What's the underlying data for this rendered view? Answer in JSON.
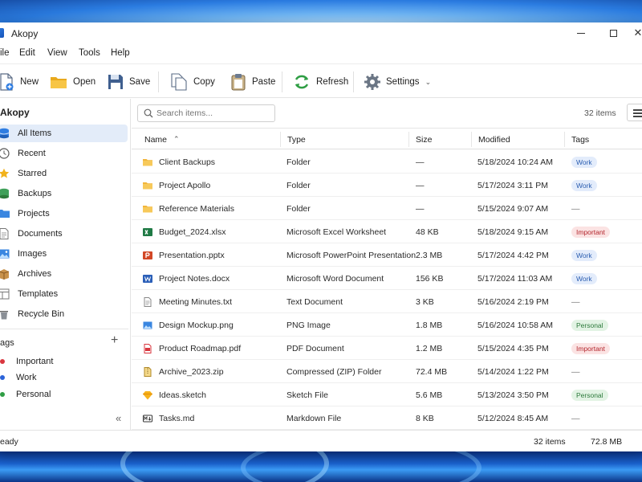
{
  "window": {
    "title": "Akopy"
  },
  "menu": [
    "ile",
    "Edit",
    "View",
    "Tools",
    "Help"
  ],
  "toolbar": {
    "new": "New",
    "open": "Open",
    "save": "Save",
    "copy": "Copy",
    "paste": "Paste",
    "refresh": "Refresh",
    "settings": "Settings"
  },
  "sidebar": {
    "header": "Akopy",
    "items": [
      {
        "label": "All Items",
        "icon": "database-icon",
        "active": true
      },
      {
        "label": "Recent",
        "icon": "clock-icon"
      },
      {
        "label": "Starred",
        "icon": "star-icon"
      },
      {
        "label": "Backups",
        "icon": "backup-icon"
      },
      {
        "label": "Projects",
        "icon": "folder-icon"
      },
      {
        "label": "Documents",
        "icon": "document-icon"
      },
      {
        "label": "Images",
        "icon": "image-icon"
      },
      {
        "label": "Archives",
        "icon": "archive-box-icon"
      },
      {
        "label": "Templates",
        "icon": "template-icon"
      },
      {
        "label": "Recycle Bin",
        "icon": "trash-icon"
      }
    ],
    "tags_header": "ags",
    "add_tag": "+",
    "tags": [
      {
        "label": "Important",
        "color": "#d9363e"
      },
      {
        "label": "Work",
        "color": "#2b63d9"
      },
      {
        "label": "Personal",
        "color": "#2f9e44"
      }
    ],
    "collapse": "«"
  },
  "main": {
    "search_placeholder": "Search items...",
    "item_count": "32 items",
    "columns": {
      "name": "Name",
      "type": "Type",
      "size": "Size",
      "modified": "Modified",
      "tags": "Tags"
    },
    "rows": [
      {
        "name": "Client Backups",
        "icon": "folder-icon",
        "type": "Folder",
        "size": "—",
        "modified": "5/18/2024 10:24 AM",
        "tag": "Work"
      },
      {
        "name": "Project Apollo",
        "icon": "folder-icon",
        "type": "Folder",
        "size": "—",
        "modified": "5/17/2024 3:11 PM",
        "tag": "Work"
      },
      {
        "name": "Reference Materials",
        "icon": "folder-icon",
        "type": "Folder",
        "size": "—",
        "modified": "5/15/2024 9:07 AM",
        "tag": "—"
      },
      {
        "name": "Budget_2024.xlsx",
        "icon": "excel-icon",
        "type": "Microsoft Excel Worksheet",
        "size": "48 KB",
        "modified": "5/18/2024 9:15 AM",
        "tag": "Important"
      },
      {
        "name": "Presentation.pptx",
        "icon": "powerpoint-icon",
        "type": "Microsoft PowerPoint Presentation",
        "size": "2.3 MB",
        "modified": "5/17/2024 4:42 PM",
        "tag": "Work"
      },
      {
        "name": "Project Notes.docx",
        "icon": "word-icon",
        "type": "Microsoft Word Document",
        "size": "156 KB",
        "modified": "5/17/2024 11:03 AM",
        "tag": "Work"
      },
      {
        "name": "Meeting Minutes.txt",
        "icon": "text-file-icon",
        "type": "Text Document",
        "size": "3 KB",
        "modified": "5/16/2024 2:19 PM",
        "tag": "—"
      },
      {
        "name": "Design Mockup.png",
        "icon": "image-file-icon",
        "type": "PNG Image",
        "size": "1.8 MB",
        "modified": "5/16/2024 10:58 AM",
        "tag": "Personal"
      },
      {
        "name": "Product Roadmap.pdf",
        "icon": "pdf-icon",
        "type": "PDF Document",
        "size": "1.2 MB",
        "modified": "5/15/2024 4:35 PM",
        "tag": "Important"
      },
      {
        "name": "Archive_2023.zip",
        "icon": "zip-icon",
        "type": "Compressed (ZIP) Folder",
        "size": "72.4 MB",
        "modified": "5/14/2024 1:22 PM",
        "tag": "—"
      },
      {
        "name": "Ideas.sketch",
        "icon": "sketch-icon",
        "type": "Sketch File",
        "size": "5.6 MB",
        "modified": "5/13/2024 3:50 PM",
        "tag": "Personal"
      },
      {
        "name": "Tasks.md",
        "icon": "markdown-icon",
        "type": "Markdown File",
        "size": "8 KB",
        "modified": "5/12/2024 8:45 AM",
        "tag": "—"
      }
    ]
  },
  "status": {
    "left": "eady",
    "count": "32 items",
    "size": "72.8 MB"
  },
  "tag_styles": {
    "Work": {
      "bg": "#e3ecfb",
      "fg": "#2a5db0"
    },
    "Important": {
      "bg": "#fbe3e3",
      "fg": "#b3262d"
    },
    "Personal": {
      "bg": "#e2f3e4",
      "fg": "#2c7a3b"
    }
  }
}
